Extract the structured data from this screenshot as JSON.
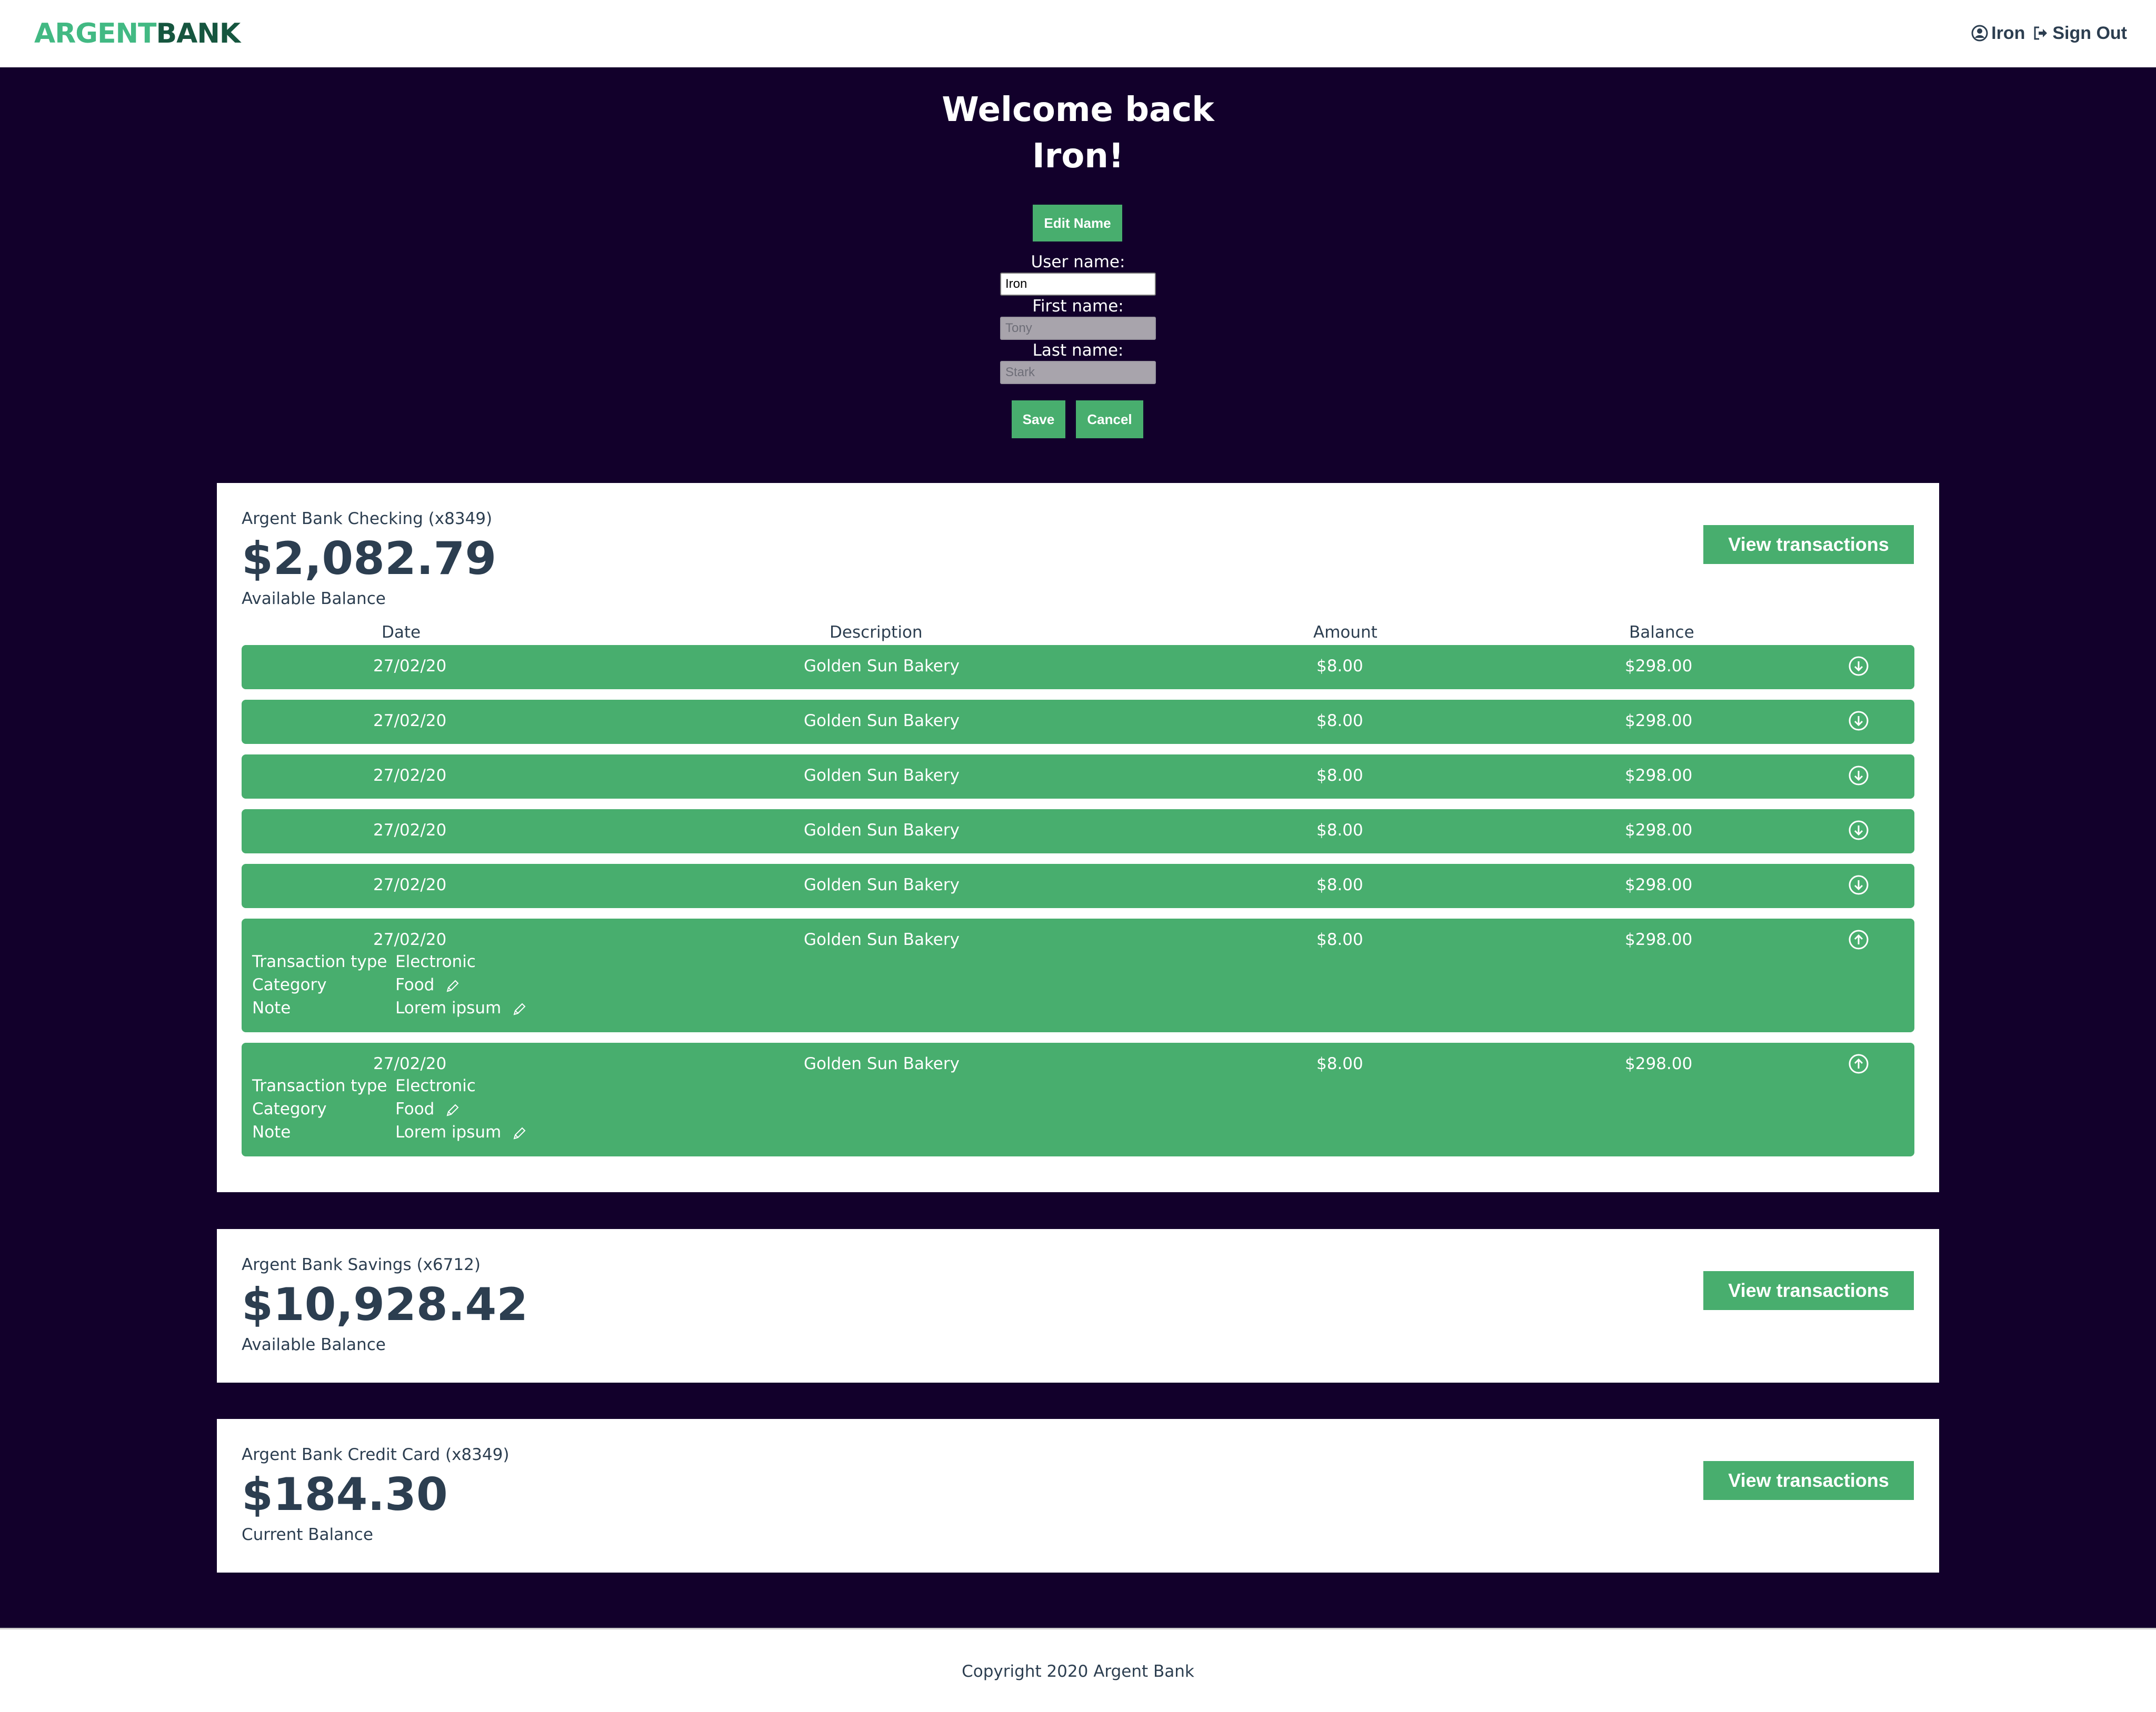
{
  "brand": {
    "part1": "ARGENT",
    "part2": "BANK"
  },
  "nav": {
    "user": "Iron",
    "sign_out": "Sign Out"
  },
  "welcome": {
    "line1": "Welcome back",
    "line2": "Iron!"
  },
  "edit": {
    "edit_label": "Edit Name",
    "username_label": "User name:",
    "username_value": "Iron",
    "firstname_label": "First name:",
    "firstname_value": "Tony",
    "lastname_label": "Last name:",
    "lastname_value": "Stark",
    "save_label": "Save",
    "cancel_label": "Cancel"
  },
  "colors": {
    "accent": "#48ae6e",
    "background": "#12002b",
    "text": "#2c3e50"
  },
  "icons": {
    "user": "user-circle-icon",
    "sign_out": "sign-out-icon",
    "expand": "chevron-down-circle-icon",
    "collapse": "chevron-up-circle-icon",
    "edit": "pencil-icon"
  },
  "accounts": [
    {
      "title": "Argent Bank Checking (x8349)",
      "amount": "$2,082.79",
      "description": "Available Balance",
      "view_label": "View transactions",
      "table_headers": {
        "date": "Date",
        "description": "Description",
        "amount": "Amount",
        "balance": "Balance"
      },
      "transactions": [
        {
          "date": "27/02/20",
          "description": "Golden Sun Bakery",
          "amount": "$8.00",
          "balance": "$298.00"
        },
        {
          "date": "27/02/20",
          "description": "Golden Sun Bakery",
          "amount": "$8.00",
          "balance": "$298.00"
        },
        {
          "date": "27/02/20",
          "description": "Golden Sun Bakery",
          "amount": "$8.00",
          "balance": "$298.00"
        },
        {
          "date": "27/02/20",
          "description": "Golden Sun Bakery",
          "amount": "$8.00",
          "balance": "$298.00"
        },
        {
          "date": "27/02/20",
          "description": "Golden Sun Bakery",
          "amount": "$8.00",
          "balance": "$298.00"
        },
        {
          "date": "27/02/20",
          "description": "Golden Sun Bakery",
          "amount": "$8.00",
          "balance": "$298.00",
          "details": {
            "type_label": "Transaction type",
            "type_value": "Electronic",
            "category_label": "Category",
            "category_value": "Food",
            "note_label": "Note",
            "note_value": "Lorem ipsum"
          }
        },
        {
          "date": "27/02/20",
          "description": "Golden Sun Bakery",
          "amount": "$8.00",
          "balance": "$298.00",
          "details": {
            "type_label": "Transaction type",
            "type_value": "Electronic",
            "category_label": "Category",
            "category_value": "Food",
            "note_label": "Note",
            "note_value": "Lorem ipsum"
          }
        }
      ]
    },
    {
      "title": "Argent Bank Savings (x6712)",
      "amount": "$10,928.42",
      "description": "Available Balance",
      "view_label": "View transactions"
    },
    {
      "title": "Argent Bank Credit Card (x8349)",
      "amount": "$184.30",
      "description": "Current Balance",
      "view_label": "View transactions"
    }
  ],
  "footer": {
    "copyright": "Copyright 2020 Argent Bank"
  }
}
